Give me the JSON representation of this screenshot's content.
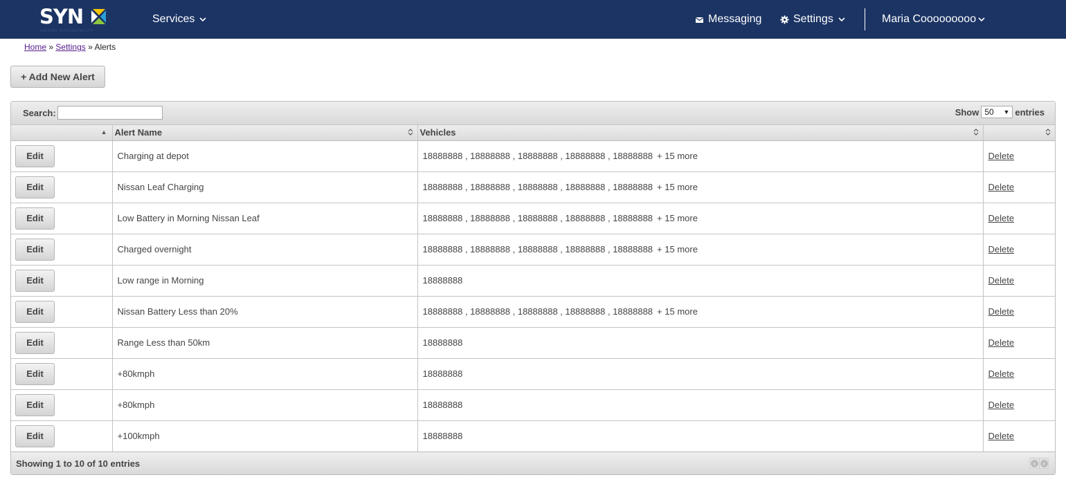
{
  "brand": {
    "logo_text": "SYN",
    "tagline": "DRIVING SYNCHRONICITY",
    "colors": {
      "nav_bg": "#1c3464",
      "logo_yellow": "#f5c400",
      "logo_blue": "#2a9fd8",
      "logo_green": "#8cc63f"
    }
  },
  "nav": {
    "services": "Services",
    "messaging": "Messaging",
    "settings": "Settings",
    "user": "Maria Cooooooooo"
  },
  "breadcrumb": {
    "home": "Home",
    "sep": "»",
    "settings": "Settings",
    "current": "Alerts"
  },
  "add_button": "+ Add New Alert",
  "table": {
    "search_label": "Search:",
    "search_value": "",
    "show_label": "Show",
    "page_size": "50",
    "entries_label": "entries",
    "columns": [
      "",
      "Alert Name",
      "Vehicles",
      ""
    ],
    "edit_label": "Edit",
    "delete_label": "Delete",
    "rows": [
      {
        "name": "Charging at depot",
        "vehicles": "18888888 , 18888888 , 18888888 , 18888888 , 18888888",
        "more": "+ 15 more"
      },
      {
        "name": "Nissan Leaf Charging",
        "vehicles": "18888888 , 18888888 , 18888888 , 18888888 , 18888888",
        "more": "+ 15 more"
      },
      {
        "name": "Low Battery in Morning Nissan Leaf",
        "vehicles": "18888888 , 18888888 , 18888888 , 18888888 , 18888888",
        "more": "+ 15 more"
      },
      {
        "name": "Charged overnight",
        "vehicles": "18888888 , 18888888 , 18888888 , 18888888 , 18888888",
        "more": "+ 15 more"
      },
      {
        "name": "Low range in Morning",
        "vehicles": "18888888",
        "more": ""
      },
      {
        "name": "Nissan Battery Less than 20%",
        "vehicles": "18888888 , 18888888 , 18888888 , 18888888 , 18888888",
        "more": "+ 15 more"
      },
      {
        "name": "Range Less than 50km",
        "vehicles": "18888888",
        "more": ""
      },
      {
        "name": "+80kmph",
        "vehicles": "18888888",
        "more": ""
      },
      {
        "name": "+80kmph",
        "vehicles": "18888888",
        "more": ""
      },
      {
        "name": "+100kmph",
        "vehicles": "18888888",
        "more": ""
      }
    ],
    "info": "Showing 1 to 10 of 10 entries"
  }
}
